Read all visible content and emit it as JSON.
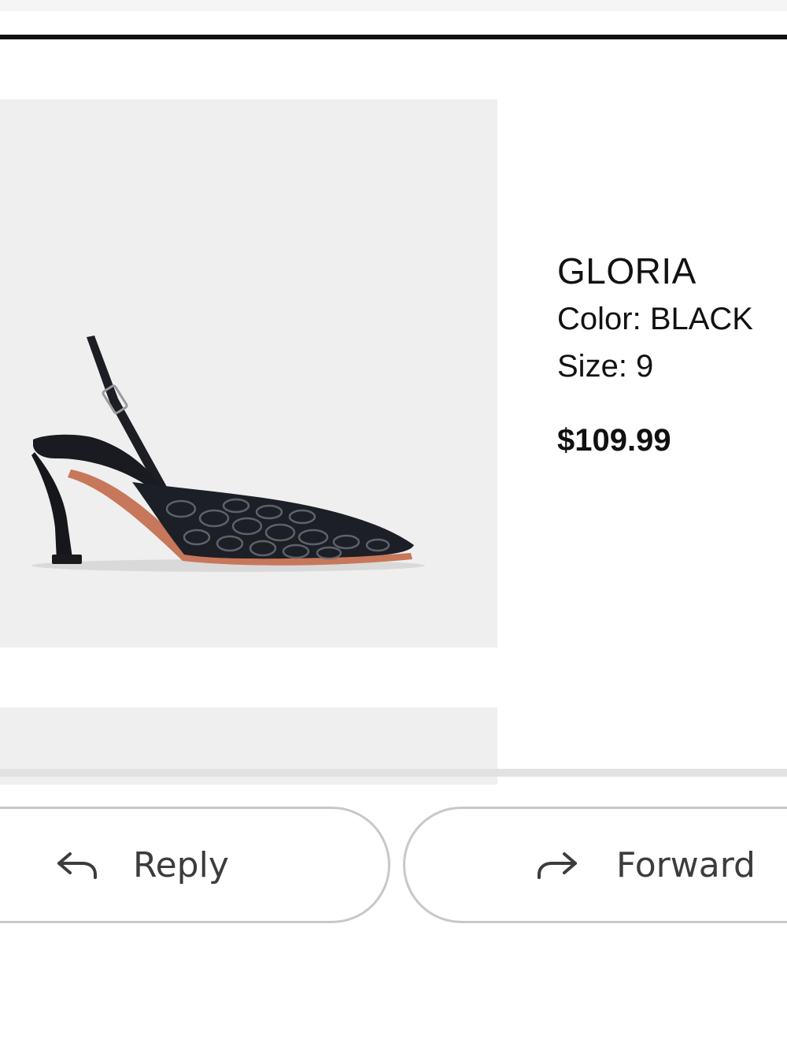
{
  "product": {
    "name": "GLORIA",
    "color_text": "Color: BLACK",
    "size_text": "Size: 9",
    "price": "$109.99",
    "image_icon": "slingback-heel-shoe"
  },
  "actions": {
    "reply_label": "Reply",
    "reply_icon": "reply-arrow-icon",
    "forward_label": "Forward",
    "forward_icon": "forward-arrow-icon"
  },
  "colors": {
    "image_background": "#efefef",
    "rule": "#111111",
    "button_border": "#c8c8c8",
    "button_text": "#3c3c3c"
  }
}
